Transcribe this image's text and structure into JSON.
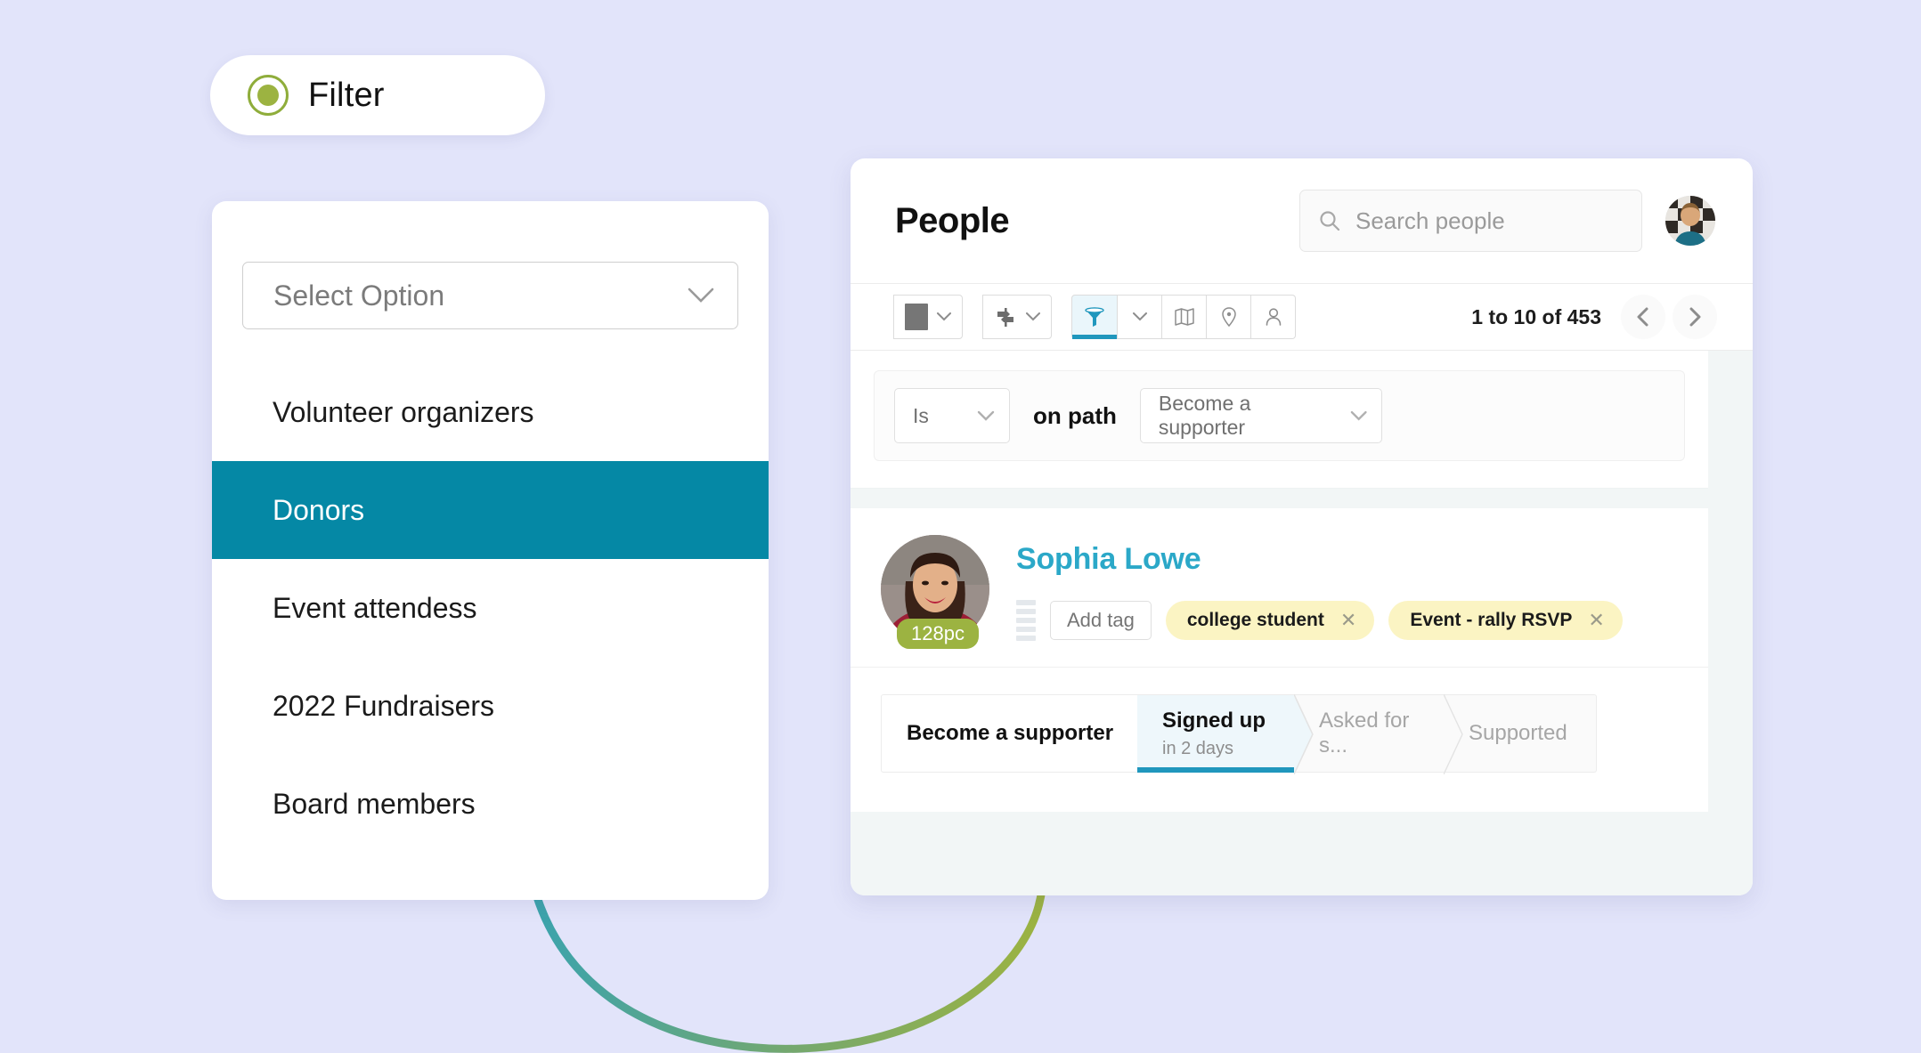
{
  "background_color": "#e2e4fa",
  "accent_teal": "#0588a5",
  "accent_green": "#9cb341",
  "link_blue": "#2ba8c8",
  "filter_pill": {
    "label": "Filter",
    "icon": "radio-selected-icon"
  },
  "select_panel": {
    "placeholder": "Select Option",
    "chevron_icon": "chevron-down-icon",
    "options": [
      {
        "label": "Volunteer organizers",
        "selected": false
      },
      {
        "label": "Donors",
        "selected": true
      },
      {
        "label": "Event attendess",
        "selected": false
      },
      {
        "label": "2022 Fundraisers",
        "selected": false
      },
      {
        "label": "Board members",
        "selected": false
      }
    ]
  },
  "app": {
    "header": {
      "title": "People",
      "search_placeholder": "Search people",
      "search_icon": "search-icon",
      "avatar": "user-avatar"
    },
    "toolbar": {
      "buttons": [
        {
          "name": "select-all-checkbox",
          "icon": "square-icon",
          "has_chevron": true,
          "active": false
        },
        {
          "name": "signpost-menu",
          "icon": "signpost-icon",
          "has_chevron": true,
          "active": false
        },
        {
          "name": "filter-view",
          "icon": "funnel-icon",
          "active": true
        },
        {
          "name": "filter-menu",
          "icon": "chevron-down-icon",
          "active": false
        },
        {
          "name": "map-view",
          "icon": "map-icon",
          "active": false
        },
        {
          "name": "location-view",
          "icon": "map-pin-icon",
          "active": false
        },
        {
          "name": "person-view",
          "icon": "person-icon",
          "active": false
        }
      ],
      "pagination": {
        "range_text": "1 to 10 of 453",
        "prev_icon": "chevron-left-icon",
        "next_icon": "chevron-right-icon"
      }
    },
    "filter_row": {
      "operator": "Is",
      "operator_chevron": "chevron-down-icon",
      "connector": "on path",
      "path_value": "Become a supporter",
      "path_chevron": "chevron-down-icon"
    },
    "person": {
      "name": "Sophia Lowe",
      "avatar": "sophia-lowe-photo",
      "score_badge": "128pc",
      "drag_handle_icon": "stacked-bars-icon",
      "add_tag_label": "Add tag",
      "tags": [
        {
          "label": "college student",
          "remove_icon": "close-icon"
        },
        {
          "label": "Event - rally RSVP",
          "remove_icon": "close-icon"
        }
      ],
      "pipeline": {
        "title": "Become a supporter",
        "stages": [
          {
            "label": "Signed up",
            "sub": "in 2 days",
            "state": "current"
          },
          {
            "label": "Asked for s...",
            "sub": "",
            "state": "upcoming"
          },
          {
            "label": "Supported",
            "sub": "",
            "state": "upcoming"
          }
        ]
      }
    }
  }
}
